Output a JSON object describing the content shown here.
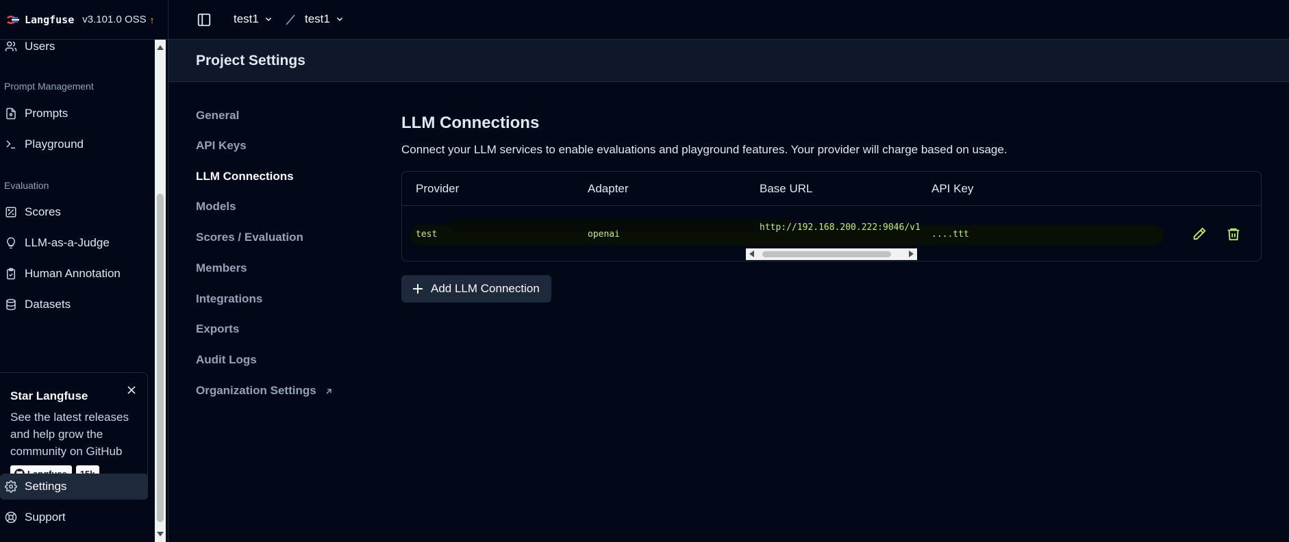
{
  "brand": {
    "name": "Langfuse",
    "version": "v3.101.0 OSS",
    "update_icon": "arrow-up-icon"
  },
  "topbar": {
    "org": "test1",
    "project": "test1"
  },
  "sidebar": {
    "items_top": [
      {
        "label": "Users",
        "icon": "users-icon"
      }
    ],
    "sections": [
      {
        "title": "Prompt Management",
        "items": [
          {
            "label": "Prompts",
            "icon": "file-icon"
          },
          {
            "label": "Playground",
            "icon": "terminal-icon"
          }
        ]
      },
      {
        "title": "Evaluation",
        "items": [
          {
            "label": "Scores",
            "icon": "scores-icon"
          },
          {
            "label": "LLM-as-a-Judge",
            "icon": "lightbulb-icon"
          },
          {
            "label": "Human Annotation",
            "icon": "clipboard-icon"
          },
          {
            "label": "Datasets",
            "icon": "database-icon"
          }
        ]
      }
    ],
    "star_card": {
      "title": "Star Langfuse",
      "description": "See the latest releases and help grow the community on GitHub",
      "github_label": "Langfuse",
      "stars": "15k"
    },
    "bottom": [
      {
        "label": "Settings",
        "icon": "gear-icon",
        "active": true
      },
      {
        "label": "Support",
        "icon": "lifebuoy-icon"
      }
    ]
  },
  "page": {
    "title": "Project Settings"
  },
  "settings_nav": [
    "General",
    "API Keys",
    "LLM Connections",
    "Models",
    "Scores / Evaluation",
    "Members",
    "Integrations",
    "Exports",
    "Audit Logs",
    "Organization Settings"
  ],
  "settings_nav_active": "LLM Connections",
  "main": {
    "title": "LLM Connections",
    "subtitle": "Connect your LLM services to enable evaluations and playground features. Your provider will charge based on usage.",
    "table": {
      "headers": [
        "Provider",
        "Adapter",
        "Base URL",
        "API Key"
      ],
      "rows": [
        {
          "provider": "test",
          "adapter": "openai",
          "base_url": "http://192.168.200.222:9046/v1",
          "api_key": "....ttt"
        }
      ]
    },
    "add_button": "Add LLM Connection"
  },
  "colors": {
    "background": "#020817",
    "header": "#0f172a",
    "highlight_text": "#bef264",
    "border": "#1e293b"
  }
}
